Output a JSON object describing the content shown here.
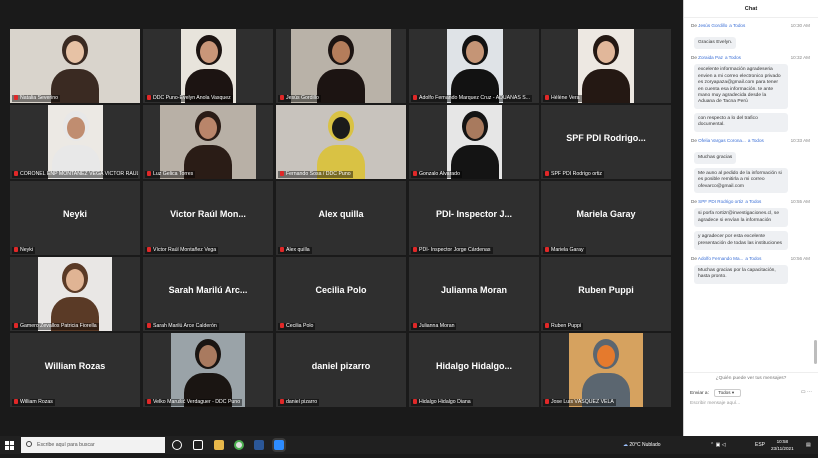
{
  "gallery": {
    "tiles": [
      {
        "label": "Natalia Severino",
        "big": "",
        "video": true
      },
      {
        "label": "DDC Puno-Evelyn Anola Vasquez",
        "big": "",
        "video": true
      },
      {
        "label": "Jesús Gordillo",
        "big": "",
        "video": true
      },
      {
        "label": "Adolfo Fernando Marquez Cruz - ADUANAS S...",
        "big": "",
        "video": true
      },
      {
        "label": "Hélène Vera",
        "big": "",
        "video": true
      },
      {
        "label": "CORONEL ENP MONTAÑEZ VEGA VÍCTOR RAÚL",
        "big": "",
        "video": true
      },
      {
        "label": "Luz Gelica Torres",
        "big": "",
        "video": true
      },
      {
        "label": "Fernando Sosa / DDC Puno",
        "big": "",
        "video": true
      },
      {
        "label": "Gonzalo Alvarado",
        "big": "",
        "video": true
      },
      {
        "label": "SPF PDI Rodrigo ortiz",
        "big": "SPF PDI Rodrigo...",
        "video": false
      },
      {
        "label": "Neyki",
        "big": "Neyki",
        "video": false
      },
      {
        "label": "Víctor Raúl Montañez Vega",
        "big": "Victor Raúl Mon...",
        "video": false
      },
      {
        "label": "Alex quilla",
        "big": "Alex quilla",
        "video": false
      },
      {
        "label": "PDI- Inspector Jorge Cárdenas",
        "big": "PDI- Inspector J...",
        "video": false
      },
      {
        "label": "Mariela Garay",
        "big": "Mariela Garay",
        "video": false
      },
      {
        "label": "Gamero Zevallos Patricia Fiorella",
        "big": "",
        "video": true
      },
      {
        "label": "Sarah Marilú Arce Calderón",
        "big": "Sarah Marilú Arc...",
        "video": false
      },
      {
        "label": "Cecilia Polo",
        "big": "Cecilia Polo",
        "video": false
      },
      {
        "label": "Julianna Moran",
        "big": "Julianna Moran",
        "video": false
      },
      {
        "label": "Ruben Puppi",
        "big": "Ruben Puppi",
        "video": false
      },
      {
        "label": "William Rozas",
        "big": "William Rozas",
        "video": false
      },
      {
        "label": "Velko Marušić Verdaguer - DDC Puno",
        "big": "",
        "video": true
      },
      {
        "label": "daniel pizarro",
        "big": "daniel pizarro",
        "video": false
      },
      {
        "label": "Hidalgo Hidalgo Diana",
        "big": "Hidalgo Hidalgo...",
        "video": false
      },
      {
        "label": "Jose Luis VÁSQUEZ VELA",
        "big": "",
        "video": true
      }
    ]
  },
  "chat": {
    "title": "Chat",
    "messages": [
      {
        "from": "Jesús Gordillo",
        "to": "a Todos",
        "time": "10:30 AM",
        "bubbles": [
          "Gracias Evelyn."
        ]
      },
      {
        "from": "Zoraida Paz",
        "to": "a Todos",
        "time": "10:32 AM",
        "bubbles": [
          "excelente información agradeseria envien a mi correo electronico privado es zoryapaza@gmail.com para tener en cuenta esa información. te ante mano muy agradecida desde la Aduana de Tacna Perú",
          "con respecto a lo del trafico documental."
        ]
      },
      {
        "from": "Ofelia Vargas Corona...",
        "to": "a Todos",
        "time": "10:33 AM",
        "bubbles": [
          "Muchas gracias",
          "Me auno al pedido de la información si es posible remitirla a mi correo ofevarco@gmail.com"
        ]
      },
      {
        "from": "SPF PDI Rodrigo ortiz",
        "to": "a Todos",
        "time": "10:55 AM",
        "bubbles": [
          "si porfa rortizr@investigaciones.cl, se agradece si envían la información",
          "y agradecer por esta excelente presentación de todas las instituciones"
        ]
      },
      {
        "from": "Adolfo Fernando Ma...",
        "to": "a Todos",
        "time": "10:56 AM",
        "bubbles": [
          "Muchas gracias por la capacitación, hasta pronto."
        ]
      }
    ],
    "who_hint": "¿Quién puede ver tus mensajes?",
    "send_to_label": "Enviar a:",
    "send_to_value": "Todos",
    "compose_placeholder": "Escribir mensaje aquí..."
  },
  "taskbar": {
    "search_placeholder": "Escribe aquí para buscar",
    "weather": "20°C Nublado",
    "lang": "ESP",
    "time": "10:58",
    "date": "23/11/2021"
  }
}
